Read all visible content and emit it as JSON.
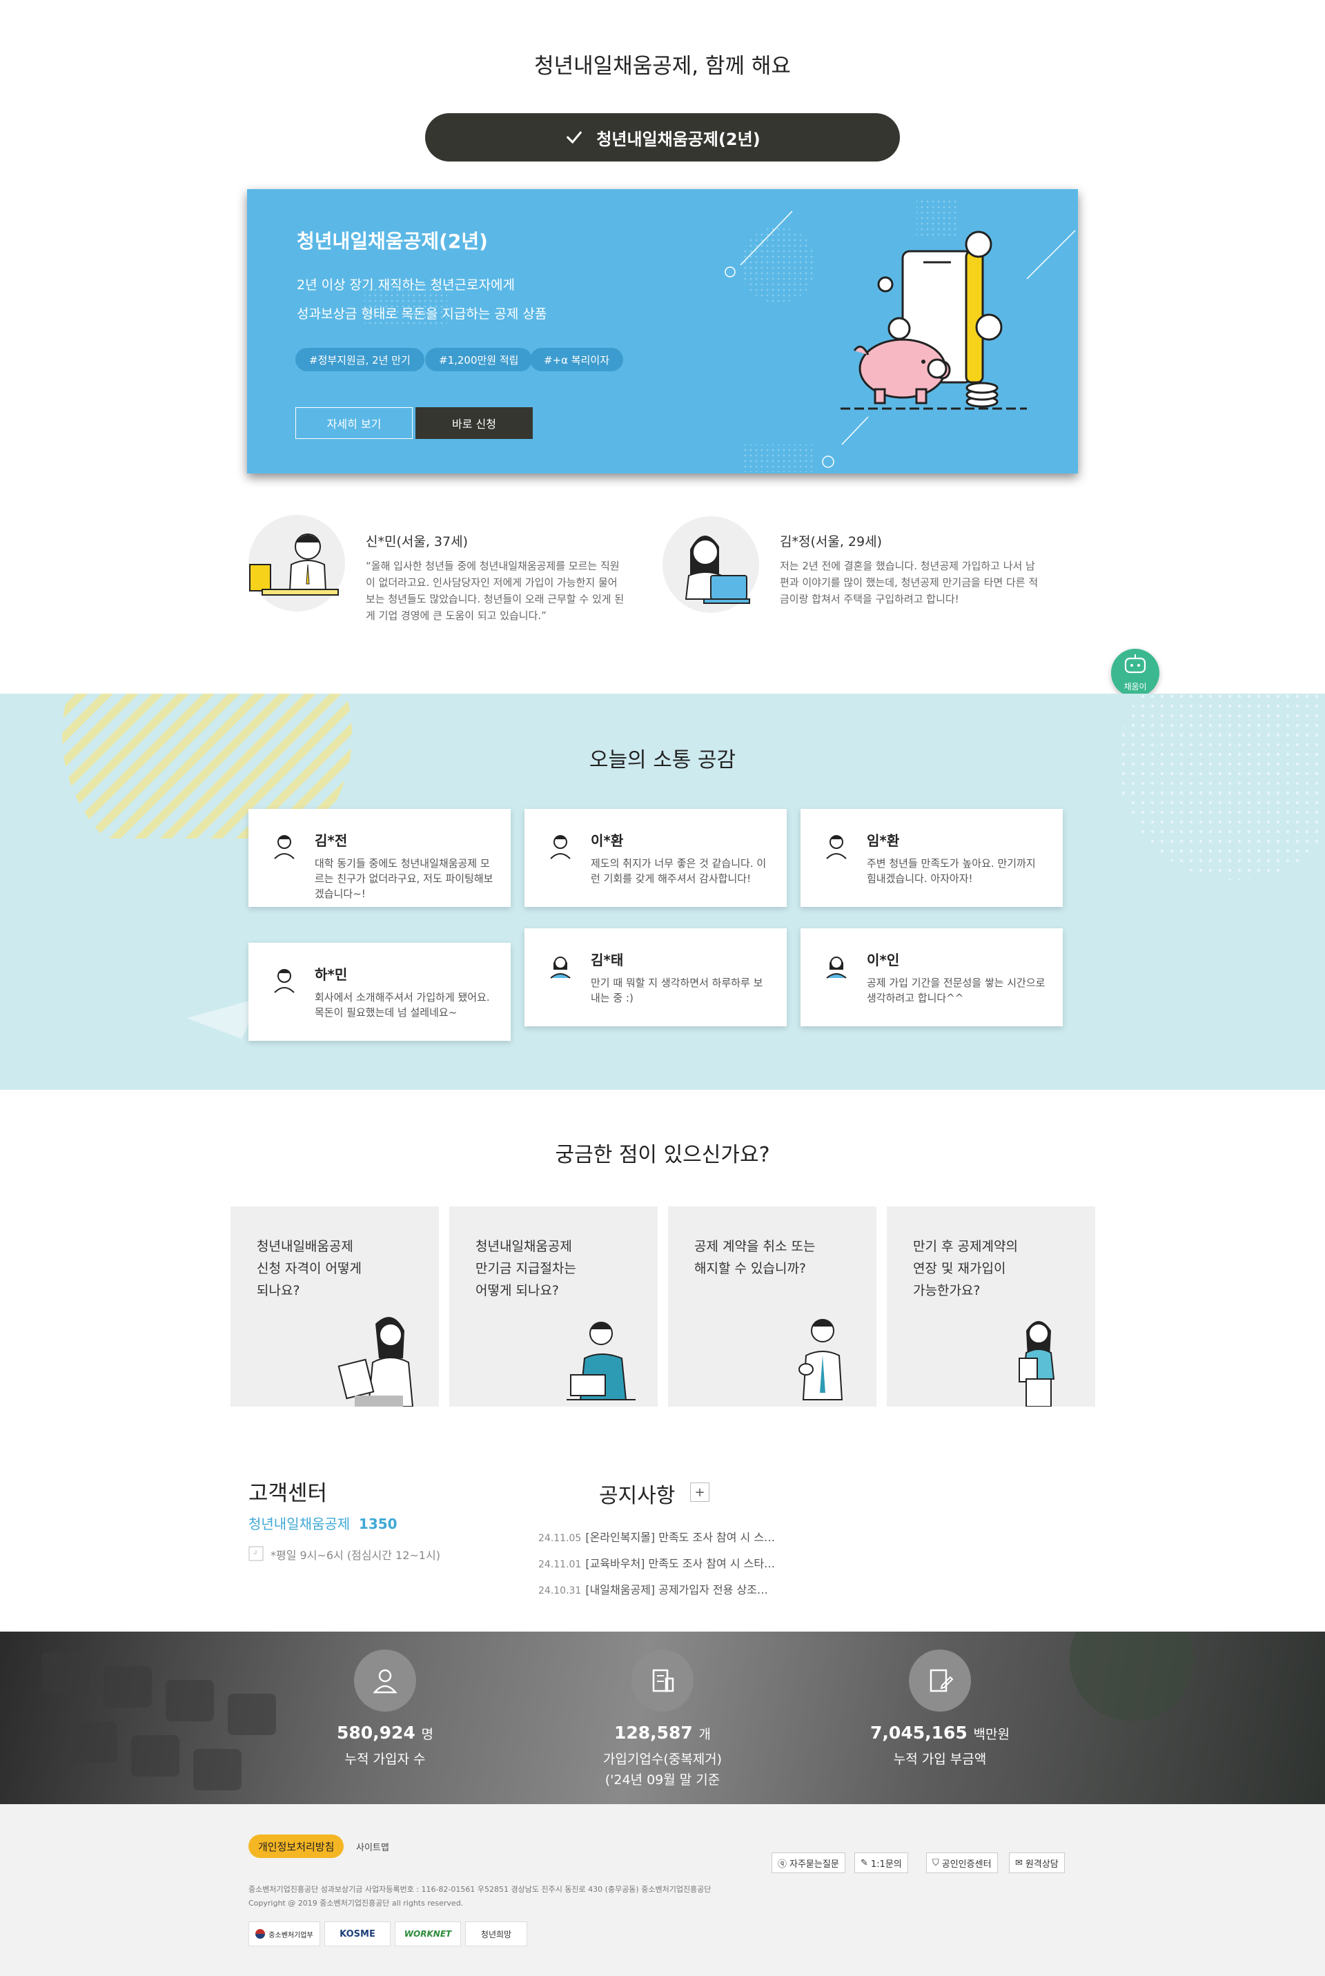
{
  "colors": {
    "sky": "#5bb8e6",
    "dark_pill": "#353630",
    "mint_bg": "#cdeaef",
    "accent_blue": "#3fa8d6",
    "privacy_yellow": "#f5b624",
    "chatbot_green": "#3bb88f"
  },
  "intro": {
    "title": "청년내일채움공제, 함께 해요",
    "tab_label": "청년내일채움공제(2년)",
    "banner": {
      "title": "청년내일채움공제(2년)",
      "line1": "2년 이상 장기 재직하는 청년근로자에게",
      "line2": "성과보상금 형태로 목돈을 지급하는 공제 상품",
      "tags": [
        "#정부지원금, 2년 만기",
        "#1,200만원 적립",
        "#+α 복리이자"
      ],
      "btn_detail": "자세히 보기",
      "btn_apply": "바로 신청"
    },
    "reviews": [
      {
        "name": "신*민(서울, 37세)",
        "text": "“올해 입사한 청년들 중에 청년내일채움공제를 모르는 직원이 없더라고요. 인사담당자인 저에게 가입이 가능한지 물어보는 청년들도 많았습니다. 청년들이 오래 근무할 수 있게 된 게 기업 경영에 큰 도움이 되고 있습니다.”"
      },
      {
        "name": "김*정(서울, 29세)",
        "text": "저는 2년 전에 결혼을 했습니다. 청년공제 가입하고 나서 남편과 이야기를 많이 했는데, 청년공제 만기금을 타면 다른 적금이랑 합쳐서 주택을 구입하려고 합니다!"
      }
    ],
    "chatbot_label": "채움이"
  },
  "community": {
    "title": "오늘의 소통 공감",
    "cards": [
      {
        "name": "김*전",
        "text": "대학 동기들 중에도 청년내일채움공제 모르는 친구가 없더라구요, 저도 파이팅해보겠습니다~!"
      },
      {
        "name": "이*환",
        "text": "제도의 취지가 너무 좋은 것 같습니다. 이런 기회를 갖게 해주셔서 감사합니다!"
      },
      {
        "name": "임*환",
        "text": "주변 청년들 만족도가 높아요. 만기까지 힘내겠습니다. 아자아자!"
      },
      {
        "name": "하*민",
        "text": "회사에서 소개해주셔서 가입하게 됐어요. 목돈이 필요했는데 넘 설레네요~"
      },
      {
        "name": "김*태",
        "text": "만기 때 뭐할 지 생각하면서 하루하루 보내는 중 :)"
      },
      {
        "name": "이*인",
        "text": "공제 가입 기간을 전문성을 쌓는 시간으로 생각하려고 합니다^^"
      }
    ]
  },
  "faq": {
    "title": "궁금한 점이 있으신가요?",
    "items": [
      {
        "line1": "청년내일배움공제",
        "line2": "신청 자격이 어떻게",
        "line3": "되나요?"
      },
      {
        "line1": "청년내일채움공제",
        "line2": "만기금 지급절차는",
        "line3": "어떻게 되나요?"
      },
      {
        "line1": "공제 계약을 취소 또는",
        "line2": "해지할 수 있습니까?",
        "line3": ""
      },
      {
        "line1": "만기 후 공제계약의",
        "line2": "연장 및 재가입이",
        "line3": "가능한가요?"
      }
    ]
  },
  "customer_center": {
    "title": "고객센터",
    "name": "청년내일채움공제",
    "phone": "1350",
    "hours": "*평일 9시~6시 (점심시간 12~1시)"
  },
  "notice": {
    "title": "공지사항",
    "plus": "+",
    "items": [
      {
        "date": "24.11.05",
        "text": "[온라인복지몰] 만족도 조사 참여 시 스…"
      },
      {
        "date": "24.11.01",
        "text": "[교육바우처] 만족도 조사 참여 시 스타…"
      },
      {
        "date": "24.10.31",
        "text": "[내일채움공제] 공제가입자 전용 상조…"
      }
    ]
  },
  "stats": [
    {
      "icon": "people-icon",
      "value": "580,924",
      "unit": "명",
      "label1": "누적 가입자 수",
      "label2": ""
    },
    {
      "icon": "building-icon",
      "value": "128,587",
      "unit": "개",
      "label1": "가입기업수(중복제거)",
      "label2": "('24년 09월 말 기준"
    },
    {
      "icon": "document-edit-icon",
      "value": "7,045,165",
      "unit": "백만원",
      "label1": "누적 가입 부금액",
      "label2": ""
    }
  ],
  "footer": {
    "privacy": "개인정보처리방침",
    "sitemap": "사이트맵",
    "links": [
      "자주묻는질문",
      "1:1문의",
      "공인인증센터",
      "원격상담"
    ],
    "address": "중소벤처기업진흥공단 성과보상기금 사업자등록번호 : 116-82-01561 우52851 경상남도 진주시 동진로 430 (충무공동) 중소벤처기업진흥공단",
    "copyright": "Copyright @ 2019 중소벤처기업진흥공단 all rights reserved.",
    "logos": [
      "중소벤처기업부",
      "KOSME",
      "WORKNET",
      "청년희망"
    ]
  }
}
